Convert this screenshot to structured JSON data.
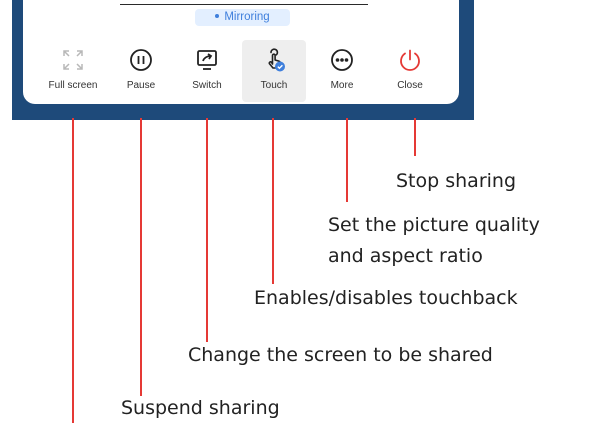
{
  "status": {
    "mirroring_label": "Mirroring"
  },
  "toolbar": {
    "full_screen": "Full screen",
    "pause": "Pause",
    "switch": "Switch",
    "touch": "Touch",
    "more": "More",
    "close": "Close"
  },
  "annotations": {
    "stop_sharing": "Stop sharing",
    "picture_quality_line1": "Set the picture quality",
    "picture_quality_line2": "and aspect ratio",
    "touchback": "Enables/disables touchback",
    "change_screen": "Change the screen to be shared",
    "suspend": "Suspend sharing"
  },
  "colors": {
    "frame": "#1e4a7a",
    "callout": "#e53935",
    "close_icon": "#e53935",
    "mirroring_accent": "#3f7fdc"
  }
}
